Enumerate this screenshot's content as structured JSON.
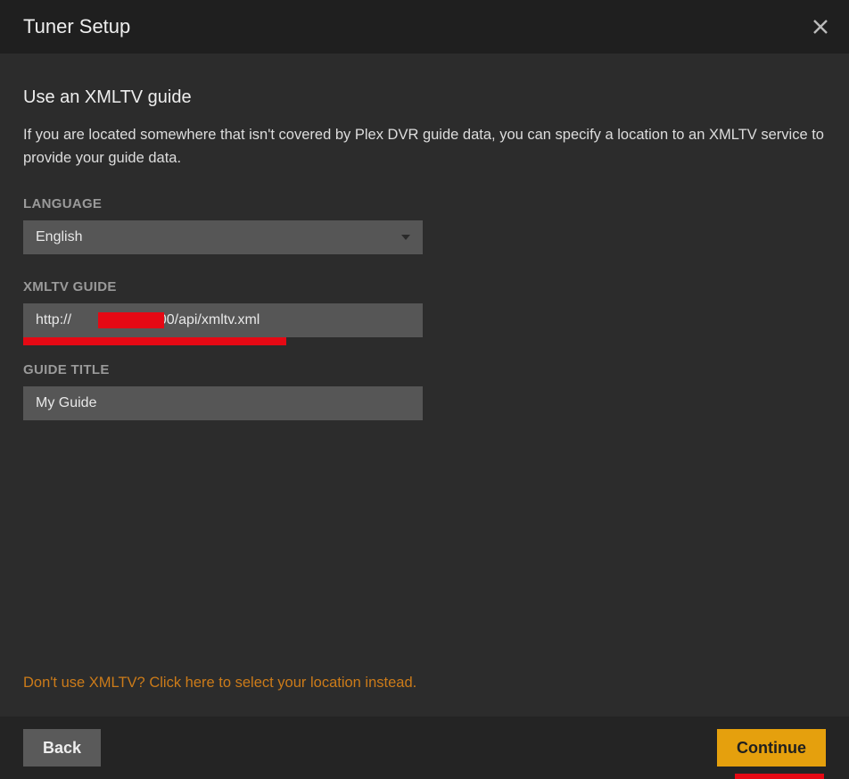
{
  "header": {
    "title": "Tuner Setup"
  },
  "section": {
    "title": "Use an XMLTV guide",
    "description": "If you are located somewhere that isn't covered by Plex DVR guide data, you can specify a location to an XMLTV service to provide your guide data."
  },
  "fields": {
    "language": {
      "label": "LANGUAGE",
      "value": "English"
    },
    "xmltv_guide": {
      "label": "XMLTV GUIDE",
      "value": "http://                 :8000/api/xmltv.xml"
    },
    "guide_title": {
      "label": "GUIDE TITLE",
      "value": "My Guide"
    }
  },
  "alt_link": "Don't use XMLTV? Click here to select your location instead.",
  "buttons": {
    "back": "Back",
    "continue": "Continue"
  }
}
